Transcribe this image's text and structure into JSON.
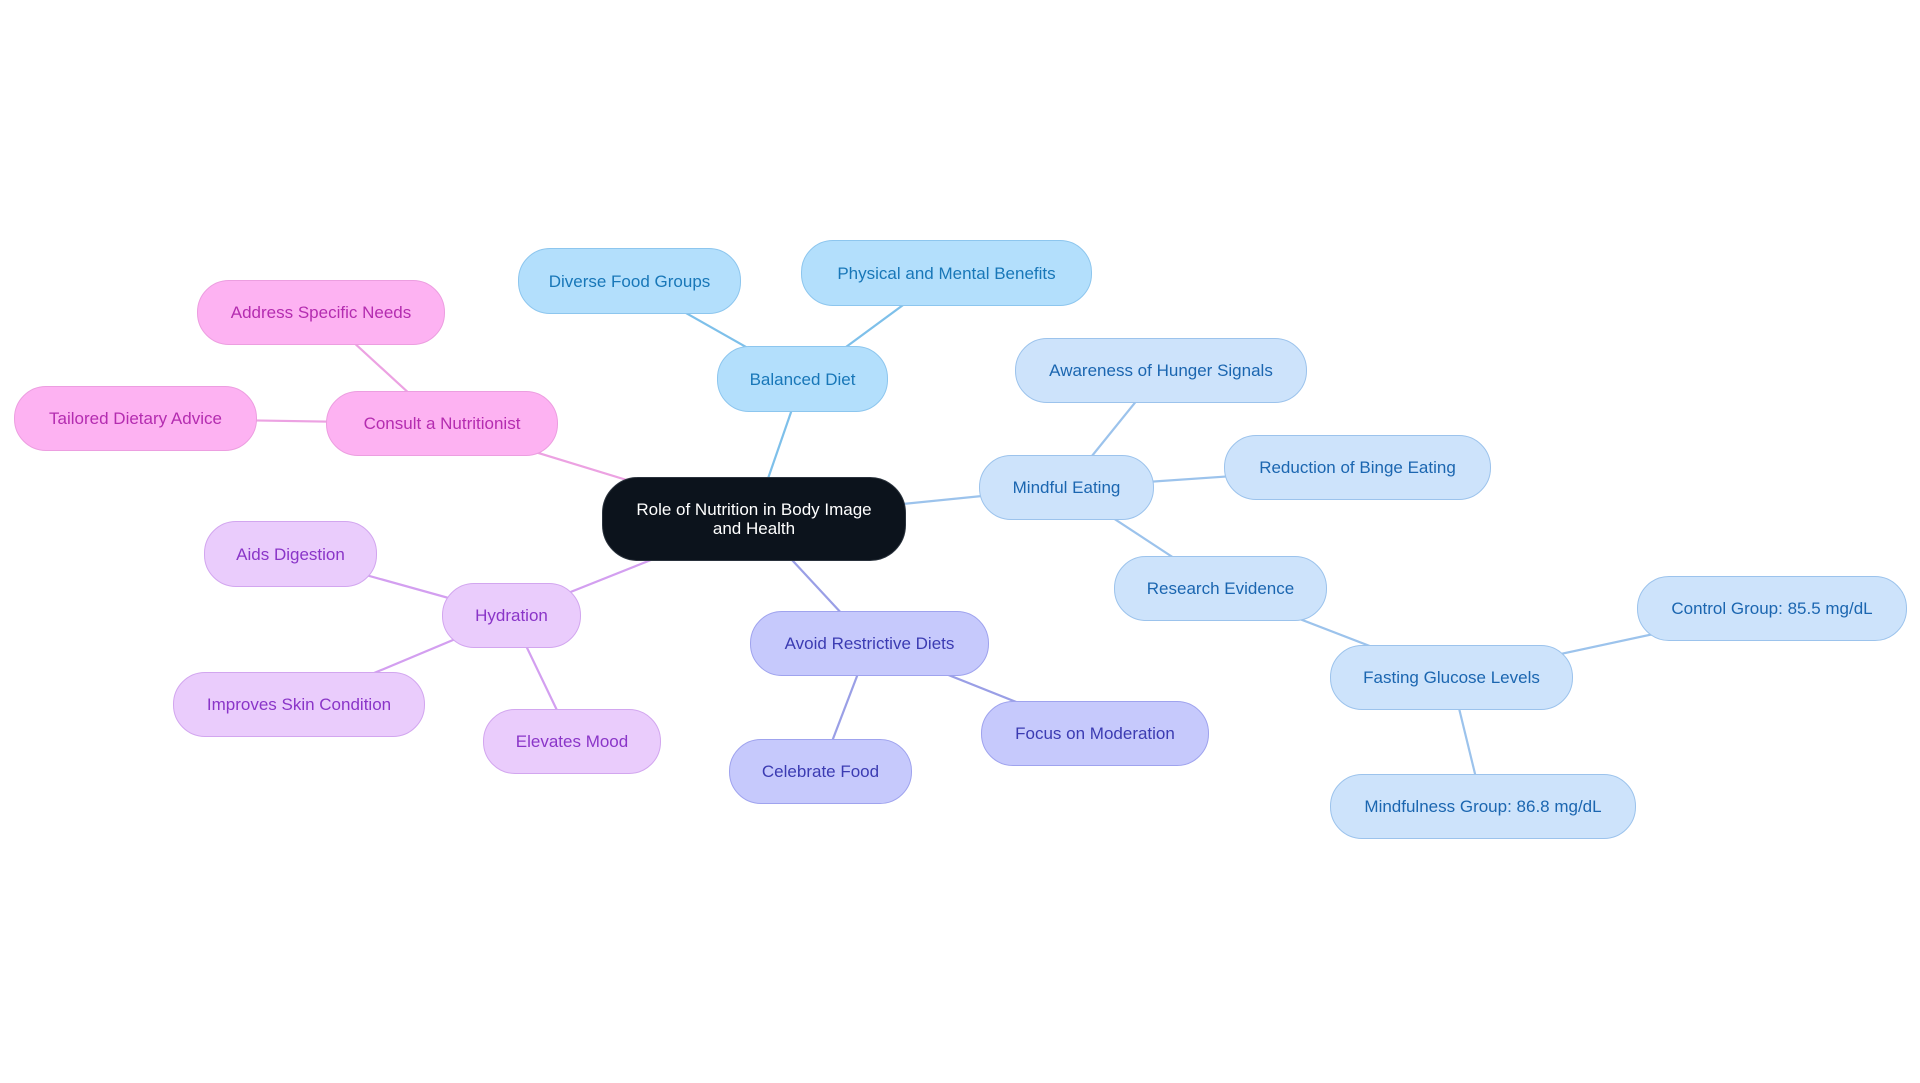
{
  "diagram": {
    "type": "mind-map",
    "root": {
      "id": "root",
      "label": "Role of Nutrition in Body Image and Health",
      "color": "#0c131c",
      "text_color": "#ffffff"
    },
    "branches": [
      {
        "id": "balanced",
        "label": "Balanced Diet",
        "theme": "sky",
        "fill": "#b3dffc",
        "stroke": "#8dc6ee",
        "text_color": "#1877b8",
        "edge_color": "#7ec0ea",
        "children": [
          {
            "id": "diverse",
            "label": "Diverse Food Groups"
          },
          {
            "id": "physical",
            "label": "Physical and Mental Benefits"
          }
        ]
      },
      {
        "id": "mindful",
        "label": "Mindful Eating",
        "theme": "blue",
        "fill": "#cde3fb",
        "stroke": "#9cc3ec",
        "text_color": "#1b66b0",
        "edge_color": "#9cc3ec",
        "children": [
          {
            "id": "aware",
            "label": "Awareness of Hunger Signals"
          },
          {
            "id": "binge",
            "label": "Reduction of Binge Eating"
          },
          {
            "id": "research",
            "label": "Research Evidence",
            "children": [
              {
                "id": "fasting",
                "label": "Fasting Glucose Levels",
                "children": [
                  {
                    "id": "control",
                    "label": "Control Group: 85.5 mg/dL"
                  },
                  {
                    "id": "mindgrp",
                    "label": "Mindfulness Group: 86.8 mg/dL"
                  }
                ]
              }
            ]
          }
        ]
      },
      {
        "id": "avoid",
        "label": "Avoid Restrictive Diets",
        "theme": "indigo",
        "fill": "#c6c9fc",
        "stroke": "#9fa3ee",
        "text_color": "#3b3bb2",
        "edge_color": "#9a9fe6",
        "children": [
          {
            "id": "moderation",
            "label": "Focus on Moderation"
          },
          {
            "id": "celebrate",
            "label": "Celebrate Food"
          }
        ]
      },
      {
        "id": "hydration",
        "label": "Hydration",
        "theme": "violet",
        "fill": "#eaccfc",
        "stroke": "#d2a6ef",
        "text_color": "#8a35c8",
        "edge_color": "#d39ff0",
        "children": [
          {
            "id": "aids",
            "label": "Aids Digestion"
          },
          {
            "id": "skin",
            "label": "Improves Skin Condition"
          },
          {
            "id": "mood",
            "label": "Elevates Mood"
          }
        ]
      },
      {
        "id": "consult",
        "label": "Consult a Nutritionist",
        "theme": "pink",
        "fill": "#fdb2f2",
        "stroke": "#ec9ee0",
        "text_color": "#b42cb0",
        "edge_color": "#eca2e2",
        "children": [
          {
            "id": "address",
            "label": "Address Specific Needs"
          },
          {
            "id": "tailored",
            "label": "Tailored Dietary Advice"
          }
        ]
      }
    ]
  },
  "labels": {
    "root": "Role of Nutrition in Body Image and Health",
    "balanced": "Balanced Diet",
    "diverse": "Diverse Food Groups",
    "physical": "Physical and Mental Benefits",
    "mindful": "Mindful Eating",
    "aware": "Awareness of Hunger Signals",
    "binge": "Reduction of Binge Eating",
    "research": "Research Evidence",
    "fasting": "Fasting Glucose Levels",
    "control": "Control Group: 85.5 mg/dL",
    "mindgrp": "Mindfulness Group: 86.8 mg/dL",
    "avoid": "Avoid Restrictive Diets",
    "moderation": "Focus on Moderation",
    "celebrate": "Celebrate Food",
    "hydration": "Hydration",
    "aids": "Aids Digestion",
    "skin": "Improves Skin Condition",
    "mood": "Elevates Mood",
    "consult": "Consult a Nutritionist",
    "address": "Address Specific Needs",
    "tailored": "Tailored Dietary Advice"
  }
}
